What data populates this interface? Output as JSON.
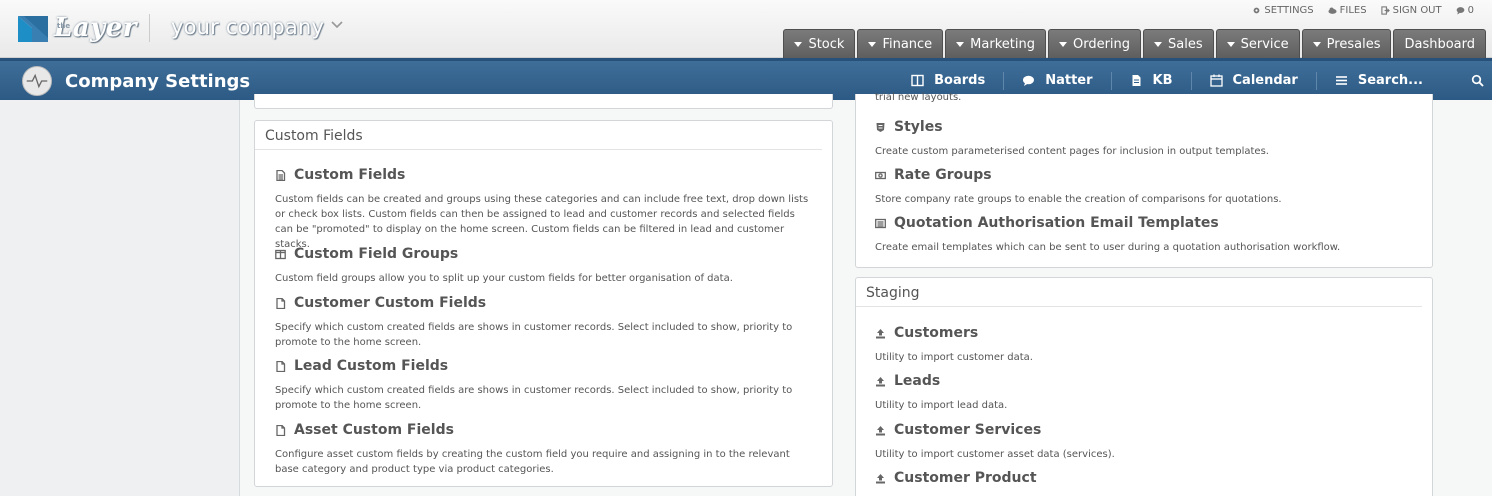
{
  "header": {
    "logo_word": "Layer",
    "logo_prefix": "the",
    "company": "your company",
    "top_links": [
      {
        "label": "SETTINGS",
        "icon": "gear-icon"
      },
      {
        "label": "FILES",
        "icon": "cloud-icon"
      },
      {
        "label": "SIGN OUT",
        "icon": "sign-out-icon"
      },
      {
        "label": "0",
        "icon": "comment-icon"
      }
    ],
    "tabs": [
      {
        "label": "Stock",
        "caret": true
      },
      {
        "label": "Finance",
        "caret": true
      },
      {
        "label": "Marketing",
        "caret": true
      },
      {
        "label": "Ordering",
        "caret": true
      },
      {
        "label": "Sales",
        "caret": true
      },
      {
        "label": "Service",
        "caret": true
      },
      {
        "label": "Presales",
        "caret": true
      },
      {
        "label": "Dashboard",
        "caret": false
      }
    ]
  },
  "titlebar": {
    "title": "Company Settings",
    "links": [
      {
        "label": "Boards",
        "icon": "columns-icon"
      },
      {
        "label": "Natter",
        "icon": "speech-bubble-icon"
      },
      {
        "label": "KB",
        "icon": "document-icon"
      },
      {
        "label": "Calendar",
        "icon": "calendar-icon"
      },
      {
        "label": "Search...",
        "icon": "menu-icon"
      }
    ]
  },
  "custom_fields_panel": {
    "title": "Custom Fields",
    "items": [
      {
        "title": "Custom Fields",
        "icon": "document-lines-icon",
        "desc": "Custom fields can be created and groups using these categories and can include free text, drop down lists or check box lists. Custom fields can then be assigned to lead and customer records and selected fields can be \"promoted\" to display on the home screen. Custom fields can be filtered in lead and customer stacks."
      },
      {
        "title": "Custom Field Groups",
        "icon": "columns-icon",
        "desc": "Custom field groups allow you to split up your custom fields for better organisation of data."
      },
      {
        "title": "Customer Custom Fields",
        "icon": "document-icon",
        "desc": "Specify which custom created fields are shows in customer records. Select included to show, priority to promote to the home screen."
      },
      {
        "title": "Lead Custom Fields",
        "icon": "document-icon",
        "desc": "Specify which custom created fields are shows in customer records. Select included to show, priority to promote to the home screen."
      },
      {
        "title": "Asset Custom Fields",
        "icon": "document-icon",
        "desc": "Configure asset custom fields by creating the custom field you require and assigning in to the relevant base category and product type via product categories."
      }
    ]
  },
  "templates_panel": {
    "partial_desc": "trial new layouts.",
    "items": [
      {
        "title": "Styles",
        "icon": "css-icon",
        "desc": "Create custom parameterised content pages for inclusion in output templates."
      },
      {
        "title": "Rate Groups",
        "icon": "money-icon",
        "desc": "Store company rate groups to enable the creation of comparisons for quotations."
      },
      {
        "title": "Quotation Authorisation Email Templates",
        "icon": "list-icon",
        "desc": "Create email templates which can be sent to user during a quotation authorisation workflow."
      }
    ]
  },
  "staging_panel": {
    "title": "Staging",
    "items": [
      {
        "title": "Customers",
        "icon": "upload-icon",
        "desc": "Utility to import customer data."
      },
      {
        "title": "Leads",
        "icon": "upload-icon",
        "desc": "Utility to import lead data."
      },
      {
        "title": "Customer Services",
        "icon": "upload-icon",
        "desc": "Utility to import customer asset data (services)."
      },
      {
        "title": "Customer Product",
        "icon": "upload-icon",
        "desc": ""
      }
    ]
  },
  "colors": {
    "title_bar": "#2f5f8b",
    "tab_bg": "#6b6b6b",
    "page_bg": "#eef0f1"
  }
}
